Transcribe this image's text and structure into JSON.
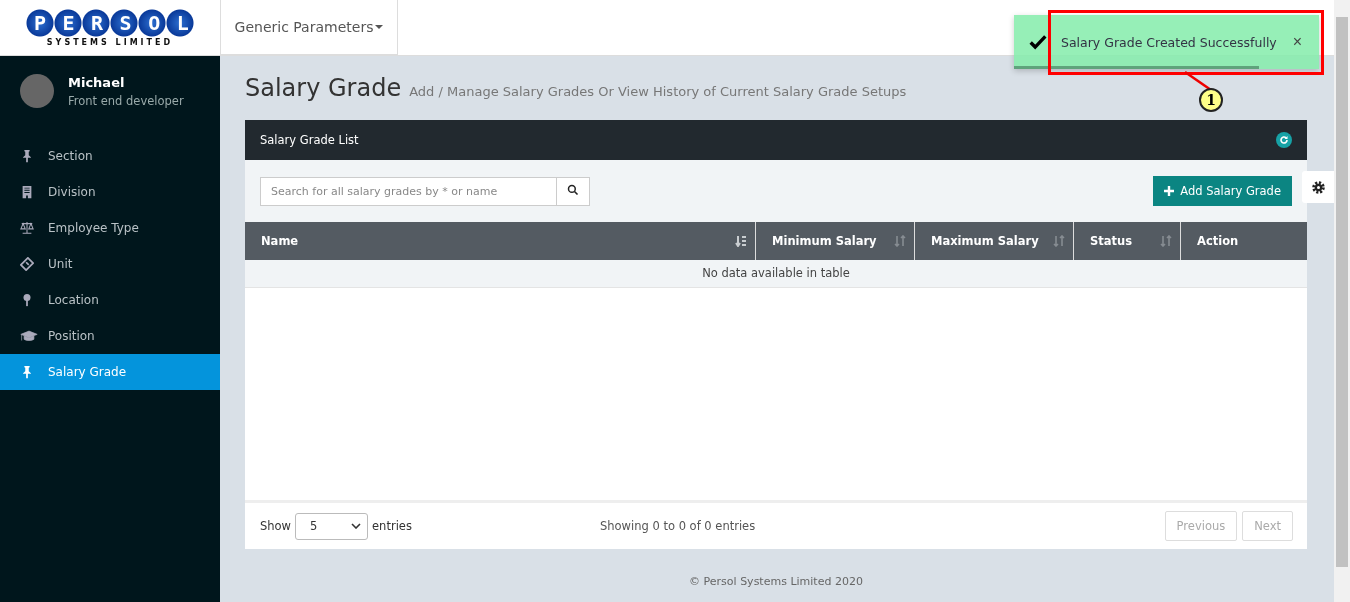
{
  "logo": {
    "name": "PERSOL",
    "tagline": "SYSTEMS LIMITED"
  },
  "header": {
    "menu": "Generic Parameters"
  },
  "profile": {
    "name": "Michael",
    "role": "Front end developer"
  },
  "sidebar": {
    "items": [
      {
        "label": "Section",
        "selected": false
      },
      {
        "label": "Division",
        "selected": false
      },
      {
        "label": "Employee Type",
        "selected": false
      },
      {
        "label": "Unit",
        "selected": false
      },
      {
        "label": "Location",
        "selected": false
      },
      {
        "label": "Position",
        "selected": false
      },
      {
        "label": "Salary Grade",
        "selected": true
      }
    ]
  },
  "page": {
    "title": "Salary Grade",
    "subtitle": "Add / Manage Salary Grades Or View History of Current Salary Grade Setups"
  },
  "panel": {
    "title": "Salary Grade List",
    "search": {
      "placeholder": "Search for all salary grades by * or name"
    },
    "add_button": "Add Salary Grade",
    "table": {
      "columns": [
        {
          "label": "Name",
          "sortable": true,
          "sorted": true
        },
        {
          "label": "Minimum Salary",
          "sortable": true,
          "sorted": false
        },
        {
          "label": "Maximum Salary",
          "sortable": true,
          "sorted": false
        },
        {
          "label": "Status",
          "sortable": true,
          "sorted": false
        },
        {
          "label": "Action",
          "sortable": false
        }
      ],
      "empty": "No data available in table"
    },
    "length": {
      "before": "Show",
      "value": "5",
      "after": "entries"
    },
    "info": "Showing 0 to 0 of 0 entries",
    "pager": [
      {
        "label": "Previous",
        "disabled": true
      },
      {
        "label": "Next",
        "disabled": true
      }
    ]
  },
  "toast": {
    "message": "Salary Grade Created Successfully",
    "close": "×"
  },
  "callout": {
    "number": "1"
  },
  "footer": "© Persol Systems Limited 2020"
}
